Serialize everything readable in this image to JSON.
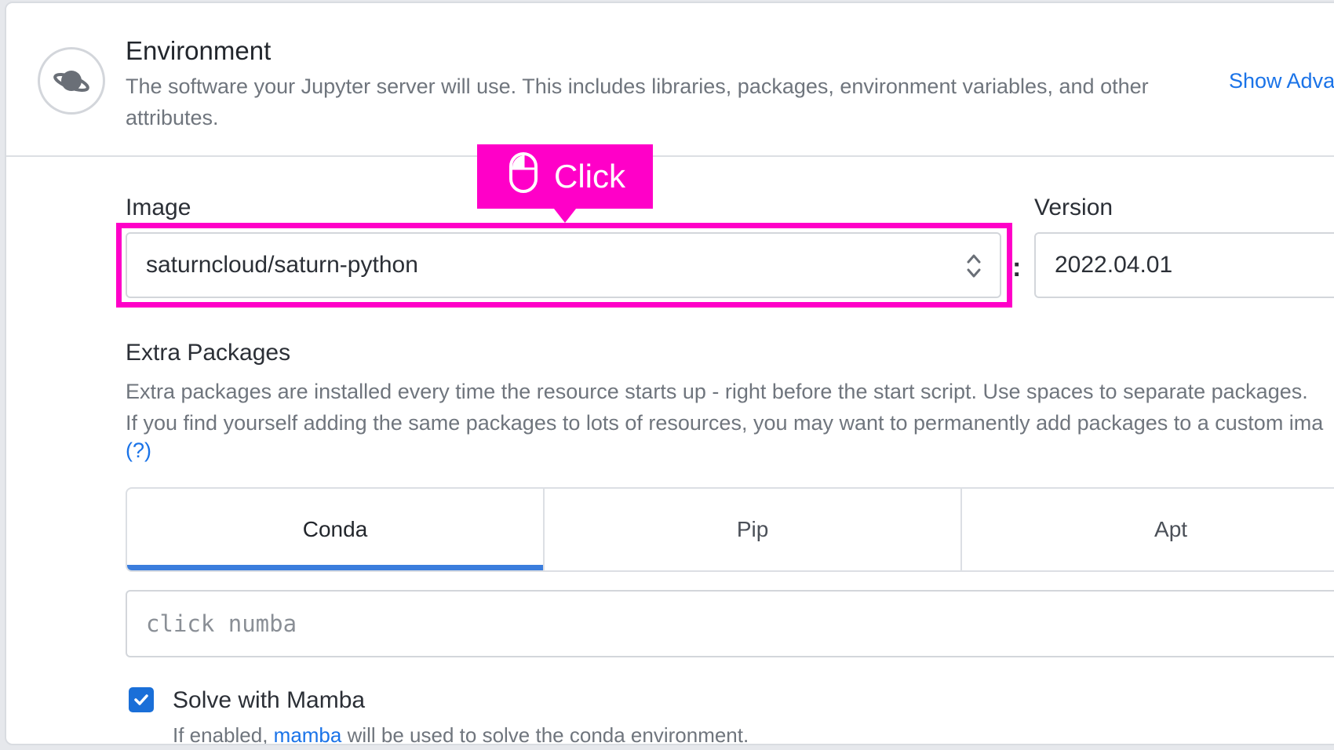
{
  "environment": {
    "title": "Environment",
    "description": "The software your Jupyter server will use. This includes libraries, packages, environment variables, and other attributes.",
    "show_advanced": "Show Adva",
    "icon": "planet-icon"
  },
  "image": {
    "label": "Image",
    "value": "saturncloud/saturn-python"
  },
  "version": {
    "label": "Version",
    "value": "2022.04.01"
  },
  "separator": ":",
  "tooltip": {
    "label": "Click",
    "icon": "mouse-icon",
    "color": "#ff00c8"
  },
  "extra_packages": {
    "title": "Extra Packages",
    "line1": "Extra packages are installed every time the resource starts up - right before the start script. Use spaces to separate packages.",
    "line2": "If you find yourself adding the same packages to lots of resources, you may want to permanently add packages to a custom ima",
    "help": "(?)",
    "tabs": [
      {
        "label": "Conda",
        "active": true
      },
      {
        "label": "Pip",
        "active": false
      },
      {
        "label": "Apt",
        "active": false
      }
    ],
    "placeholder": "click numba"
  },
  "mamba": {
    "checked": true,
    "label": "Solve with Mamba",
    "desc_prefix": "If enabled, ",
    "desc_link": "mamba",
    "desc_suffix": " will be used to solve the conda environment."
  },
  "colors": {
    "accent": "#1a73e8",
    "tab_indicator": "#3b7ddd",
    "highlight": "#ff00c8"
  }
}
